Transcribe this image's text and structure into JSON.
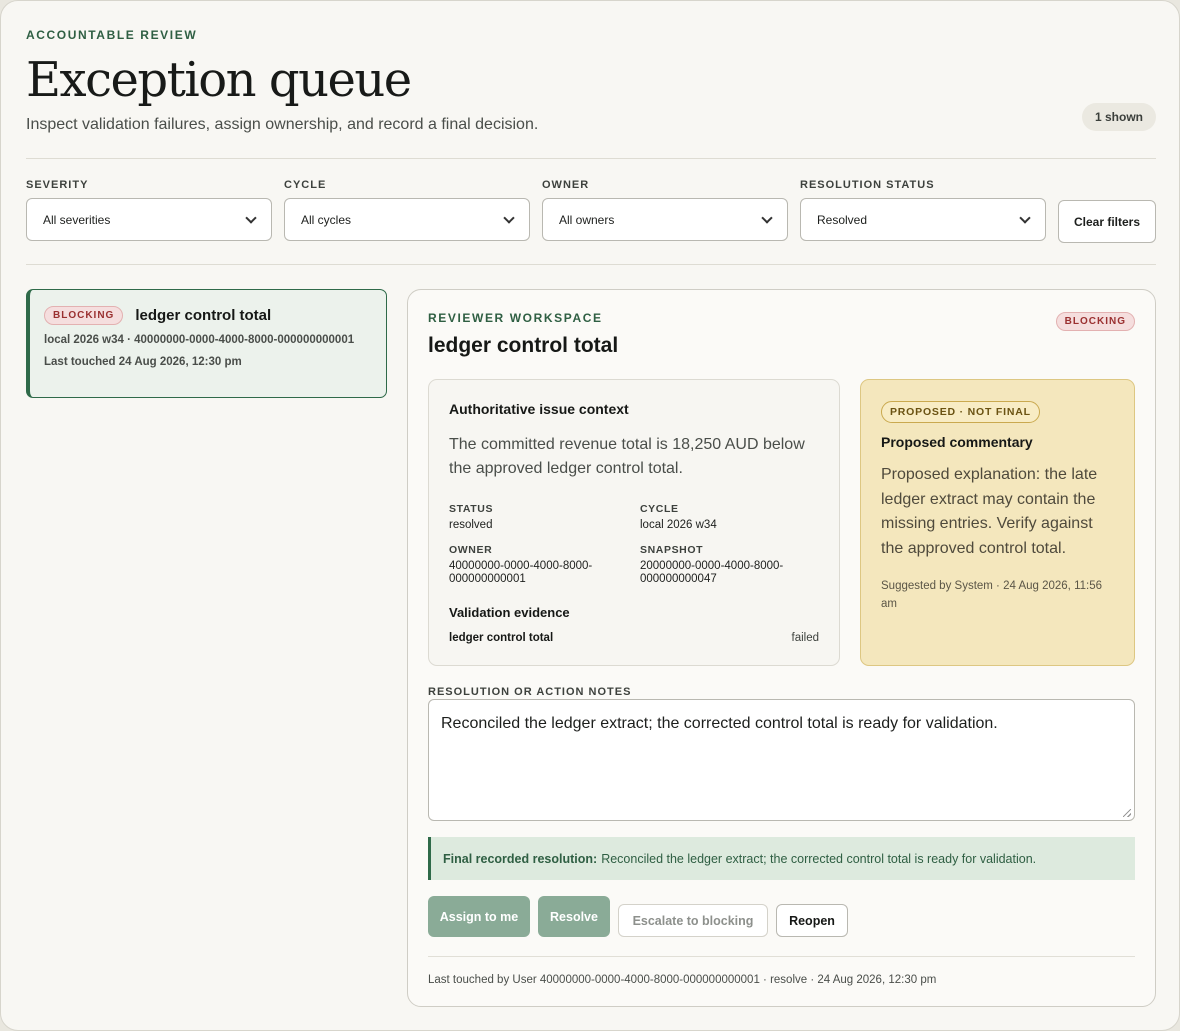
{
  "header": {
    "eyebrow": "ACCOUNTABLE REVIEW",
    "title": "Exception queue",
    "subtitle": "Inspect validation failures, assign ownership, and record a final decision.",
    "shown_count": "1 shown"
  },
  "filters": {
    "severity": {
      "label": "SEVERITY",
      "value": "All severities"
    },
    "cycle": {
      "label": "CYCLE",
      "value": "All cycles"
    },
    "owner": {
      "label": "OWNER",
      "value": "All owners"
    },
    "resolution_status": {
      "label": "RESOLUTION STATUS",
      "value": "Resolved"
    },
    "clear_label": "Clear filters"
  },
  "queue": {
    "items": [
      {
        "badge": "BLOCKING",
        "title": "ledger control total",
        "meta": "local 2026 w34 · 40000000-0000-4000-8000-000000000001",
        "touched": "Last touched 24 Aug 2026, 12:30 pm"
      }
    ]
  },
  "workspace": {
    "eyebrow": "REVIEWER WORKSPACE",
    "title": "ledger control total",
    "badge": "BLOCKING",
    "context": {
      "heading": "Authoritative issue context",
      "body": "The committed revenue total is 18,250 AUD below the approved ledger control total.",
      "status_label": "STATUS",
      "status_value": "resolved",
      "cycle_label": "CYCLE",
      "cycle_value": "local 2026 w34",
      "owner_label": "OWNER",
      "owner_value": "40000000-0000-4000-8000-000000000001",
      "snapshot_label": "SNAPSHOT",
      "snapshot_value": "20000000-0000-4000-8000-000000000047",
      "evidence_heading": "Validation evidence",
      "evidence_name": "ledger control total",
      "evidence_status": "failed"
    },
    "proposed": {
      "badge": "PROPOSED · NOT FINAL",
      "heading": "Proposed commentary",
      "body": "Proposed explanation: the late ledger extract may contain the missing entries. Verify against the approved control total.",
      "footer": "Suggested by System · 24 Aug 2026, 11:56 am"
    },
    "notes_label": "RESOLUTION OR ACTION NOTES",
    "notes_value": "Reconciled the ledger extract; the corrected control total is ready for validation.",
    "final_label": "Final recorded resolution:",
    "final_text": "Reconciled the ledger extract; the corrected control total is ready for validation.",
    "actions": {
      "assign": "Assign to me",
      "resolve": "Resolve",
      "escalate": "Escalate to blocking",
      "reopen": "Reopen"
    },
    "footer": "Last touched by User 40000000-0000-4000-8000-000000000001 · resolve · 24 Aug 2026, 12:30 pm"
  }
}
